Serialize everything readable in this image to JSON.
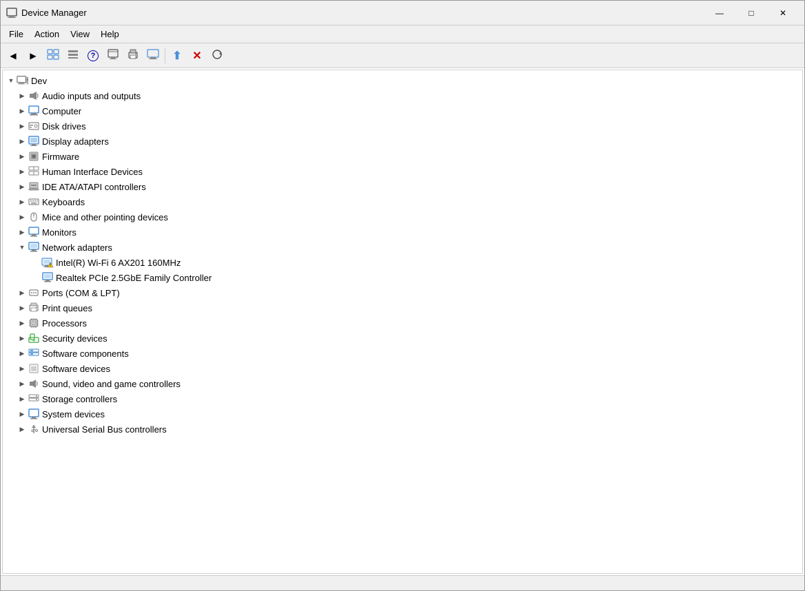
{
  "window": {
    "title": "Device Manager",
    "icon": "🖥"
  },
  "titlebar": {
    "minimize": "—",
    "maximize": "□",
    "close": "✕"
  },
  "menu": {
    "items": [
      "File",
      "Action",
      "View",
      "Help"
    ]
  },
  "toolbar": {
    "buttons": [
      {
        "name": "back",
        "label": "◀"
      },
      {
        "name": "forward",
        "label": "▶"
      },
      {
        "name": "device-manager-view",
        "label": "⊞"
      },
      {
        "name": "properties",
        "label": "▤"
      },
      {
        "name": "help",
        "label": "?"
      },
      {
        "name": "resources-view",
        "label": "⊟"
      },
      {
        "name": "print",
        "label": "⎙"
      },
      {
        "name": "monitor",
        "label": "🖥"
      },
      {
        "name": "update-driver",
        "label": "⬆"
      },
      {
        "name": "uninstall",
        "label": "✕"
      },
      {
        "name": "scan-changes",
        "label": "⟳"
      }
    ]
  },
  "tree": {
    "root": {
      "label": "Dev",
      "expanded": true,
      "children": [
        {
          "label": "Audio inputs and outputs",
          "icon": "🔊",
          "indent": 1,
          "expanded": false
        },
        {
          "label": "Computer",
          "icon": "🖥",
          "indent": 1,
          "expanded": false
        },
        {
          "label": "Disk drives",
          "icon": "💿",
          "indent": 1,
          "expanded": false
        },
        {
          "label": "Display adapters",
          "icon": "🖵",
          "indent": 1,
          "expanded": false
        },
        {
          "label": "Firmware",
          "icon": "⬛",
          "indent": 1,
          "expanded": false
        },
        {
          "label": "Human Interface Devices",
          "icon": "🎮",
          "indent": 1,
          "expanded": false
        },
        {
          "label": "IDE ATA/ATAPI controllers",
          "icon": "⬛",
          "indent": 1,
          "expanded": false
        },
        {
          "label": "Keyboards",
          "icon": "⌨",
          "indent": 1,
          "expanded": false
        },
        {
          "label": "Mice and other pointing devices",
          "icon": "🖱",
          "indent": 1,
          "expanded": false
        },
        {
          "label": "Monitors",
          "icon": "🖵",
          "indent": 1,
          "expanded": false
        },
        {
          "label": "Network adapters",
          "icon": "🖵",
          "indent": 1,
          "expanded": true
        },
        {
          "label": "Intel(R) Wi-Fi 6 AX201 160MHz",
          "icon": "⚠",
          "indent": 2,
          "warning": true,
          "expanded": false
        },
        {
          "label": "Realtek PCIe 2.5GbE Family Controller",
          "icon": "🖵",
          "indent": 2,
          "expanded": false
        },
        {
          "label": "Ports (COM & LPT)",
          "icon": "⬛",
          "indent": 1,
          "expanded": false
        },
        {
          "label": "Print queues",
          "icon": "⬛",
          "indent": 1,
          "expanded": false
        },
        {
          "label": "Processors",
          "icon": "⬛",
          "indent": 1,
          "expanded": false
        },
        {
          "label": "Security devices",
          "icon": "🔒",
          "indent": 1,
          "expanded": false
        },
        {
          "label": "Software components",
          "icon": "⬛",
          "indent": 1,
          "expanded": false
        },
        {
          "label": "Software devices",
          "icon": "⬛",
          "indent": 1,
          "expanded": false
        },
        {
          "label": "Sound, video and game controllers",
          "icon": "🔊",
          "indent": 1,
          "expanded": false
        },
        {
          "label": "Storage controllers",
          "icon": "⬛",
          "indent": 1,
          "expanded": false
        },
        {
          "label": "System devices",
          "icon": "🖵",
          "indent": 1,
          "expanded": false
        },
        {
          "label": "Universal Serial Bus controllers",
          "icon": "⬛",
          "indent": 1,
          "expanded": false
        }
      ]
    }
  }
}
